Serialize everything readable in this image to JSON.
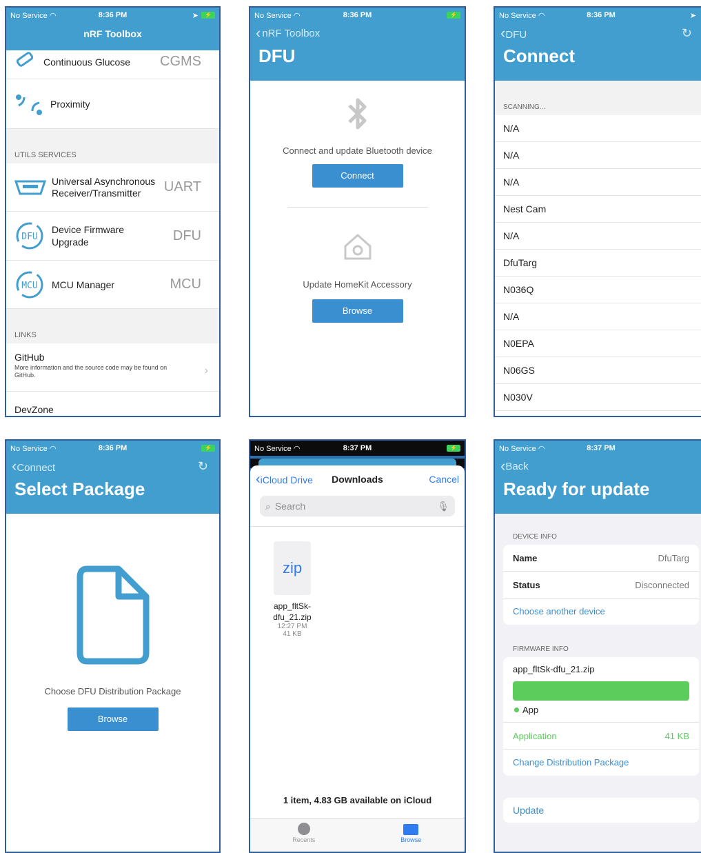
{
  "status": {
    "carrier": "No Service",
    "time1": "8:36 PM",
    "time2": "8:37 PM"
  },
  "screen1": {
    "nav_title": "nRF Toolbox",
    "top_items": [
      {
        "label": "Continuous Glucose",
        "abbr": "CGMS"
      },
      {
        "label": "Proximity",
        "abbr": ""
      }
    ],
    "utils_header": "UTILS SERVICES",
    "utils": [
      {
        "label": "Universal Asynchronous Receiver/Transmitter",
        "abbr": "UART",
        "icon": "uart-icon"
      },
      {
        "label": "Device Firmware Upgrade",
        "abbr": "DFU",
        "icon": "dfu-icon"
      },
      {
        "label": "MCU Manager",
        "abbr": "MCU",
        "icon": "mcu-icon"
      }
    ],
    "links_header": "LINKS",
    "links": [
      {
        "title": "GitHub",
        "desc": "More information and the source code may be found on GitHub."
      },
      {
        "title": "DevZone",
        "desc": ""
      }
    ],
    "icon_text": {
      "dfu": "DFU",
      "mcu": "MCU"
    }
  },
  "screen2": {
    "back": "nRF Toolbox",
    "title": "DFU",
    "connect_text": "Connect and update Bluetooth device",
    "connect_btn": "Connect",
    "homekit_text": "Update HomeKit Accessory",
    "browse_btn": "Browse"
  },
  "screen3": {
    "back": "DFU",
    "title": "Connect",
    "scanning": "SCANNING...",
    "devices": [
      "N/A",
      "N/A",
      "N/A",
      "Nest Cam",
      "N/A",
      "DfuTarg",
      "N036Q",
      "N/A",
      "N0EPA",
      "N06GS",
      "N030V"
    ]
  },
  "screen4": {
    "back": "Connect",
    "title": "Select Package",
    "choose_text": "Choose DFU Distribution Package",
    "browse_btn": "Browse"
  },
  "screen5": {
    "back": "iCloud Drive",
    "title": "Downloads",
    "cancel": "Cancel",
    "search_placeholder": "Search",
    "file": {
      "ext": "zip",
      "name_line1": "app_fltSk-",
      "name_line2": "dfu_21.zip",
      "time": "12:27 PM",
      "size": "41 KB"
    },
    "footer": "1 item, 4.83 GB available on iCloud",
    "tabs": [
      {
        "label": "Recents"
      },
      {
        "label": "Browse"
      }
    ]
  },
  "screen6": {
    "back": "Back",
    "title": "Ready for update",
    "device_header": "DEVICE INFO",
    "name_label": "Name",
    "name_value": "DfuTarg",
    "status_label": "Status",
    "status_value": "Disconnected",
    "choose_another": "Choose another device",
    "firmware_header": "FIRMWARE INFO",
    "package": "app_fltSk-dfu_21.zip",
    "legend": "App",
    "app_label": "Application",
    "app_size": "41 KB",
    "change_pkg": "Change Distribution Package",
    "update": "Update",
    "bar_fraction": 1.0
  },
  "colors": {
    "header": "#419ecf",
    "button": "#3a8fd0",
    "ios_blue": "#2f7bf0",
    "green": "#5ccc5c"
  }
}
